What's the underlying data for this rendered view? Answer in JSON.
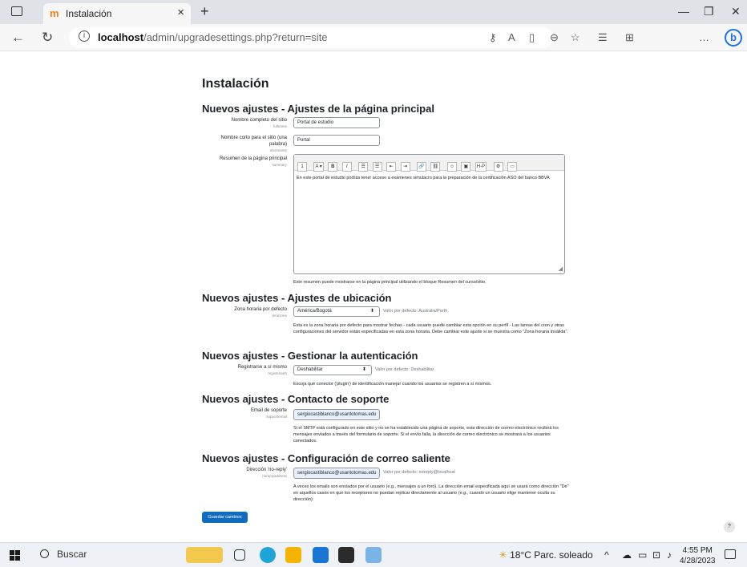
{
  "browser": {
    "tab_title": "Instalación",
    "tab_close": "×",
    "new_tab": "+",
    "url_host": "localhost",
    "url_path": "/admin/upgradesettings.php?return=site",
    "info_glyph": "i"
  },
  "page": {
    "title": "Instalación",
    "sections": {
      "front": "Nuevos ajustes - Ajustes de la página principal",
      "location": "Nuevos ajustes - Ajustes de ubicación",
      "auth": "Nuevos ajustes - Gestionar la autenticación",
      "support": "Nuevos ajustes - Contacto de soporte",
      "mail": "Nuevos ajustes - Configuración de correo saliente"
    },
    "fullname": {
      "label": "Nombre completo del sitio",
      "key": "fullname",
      "value": "Portal de estudio"
    },
    "shortname": {
      "label": "Nombre corto para el sitio (una palabra)",
      "key": "shortname",
      "value": "Portal"
    },
    "summary": {
      "label": "Resumen de la página principal",
      "key": "summary",
      "text": "En este portal de estudio podrás tener acceso a exámenes simulacro para la preparación de la certificación ASO del banco BBVA",
      "help": "Este resumen puede mostrarse en la página principal utilizando el bloque Resumen del curso/sitio."
    },
    "editor_toolbar": [
      "1",
      "A ▾",
      "B",
      "I",
      "☰",
      "☰",
      "⇤",
      "⇥",
      "🔗",
      "⛓",
      "☺",
      "▣",
      "H-P",
      "⚙",
      "▭"
    ],
    "timezone": {
      "label": "Zona horaria por defecto",
      "key": "timezone",
      "value": "América/Bogotá",
      "default": "Valor por defecto: Australia/Perth",
      "help": "Esta es la zona horaria por defecto para mostrar fechas - cada usuario puede cambiar esta opción en su perfil - Las tareas del cron y otras configuraciones del servidor están especificadas en esta zona horaria. Debe cambiar este ajuste si se muestra como \"Zona horaria inválida\"."
    },
    "registerauth": {
      "label": "Registrarse a sí mismo",
      "key": "registerauth",
      "value": "Deshabilitar",
      "default": "Valor por defecto: Deshabilitar",
      "help": "Escoja qué conector ('plugin') de identificación manejar cuando los usuarios se registren a sí mismos."
    },
    "supportemail": {
      "label": "Email de soporte",
      "key": "supportemail",
      "value": "sergiocastiblanco@usantotomas.edu",
      "help": "Si el SMTP está configurado en este sitio y no se ha establecido una página de soporte, esta dirección de correo electrónico recibirá los mensajes enviados a través del formulario de soporte. Si el envío falla, la dirección de correo electrónico se mostrará a los usuarios conectados."
    },
    "noreply": {
      "label": "Dirección 'no-reply'",
      "key": "noreplyaddress",
      "value": "sergiocastiblanco@usantotomas.edu",
      "default": "Valor por defecto: noreply@localhost",
      "help": "A veces los emails son enviados por el usuario (e.g., mensajes a un foro). La dirección email especificada aquí se usará como dirección \"De\" en aquellos casos en que los receptores no puedan replicar directamente al usuario (e.g., cuando un usuario elige mantener oculta su dirección)."
    },
    "save_label": "Guardar cambios",
    "help_glyph": "?"
  },
  "taskbar": {
    "search_label": "Buscar",
    "weather": "18°C Parc. soleado",
    "time": "4:55 PM",
    "date": "4/28/2023"
  },
  "colors": {
    "accent": "#0f6cbf",
    "taskbar": "#eef1f6",
    "tabbar": "#dfe3e8"
  }
}
